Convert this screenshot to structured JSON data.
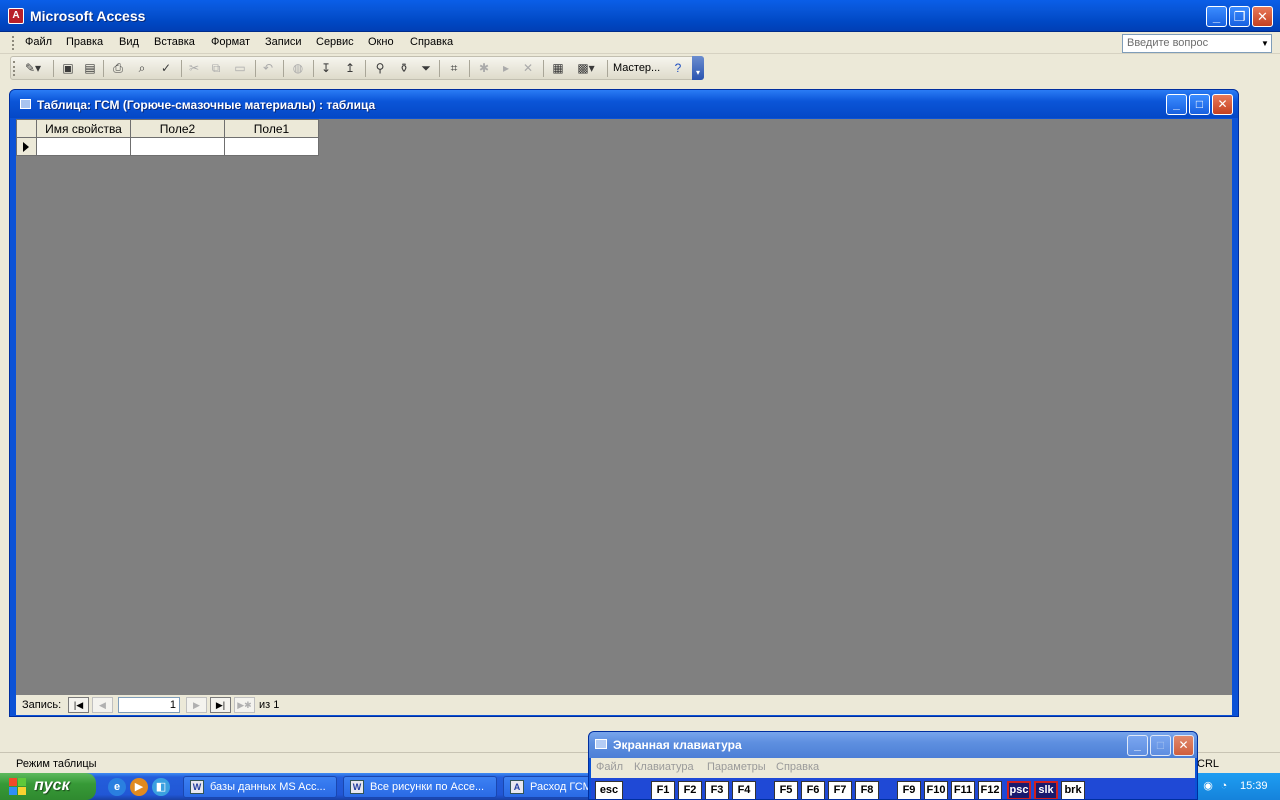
{
  "app": {
    "title": "Microsoft Access",
    "icon": "access-app-icon"
  },
  "menu": {
    "items": [
      "Файл",
      "Правка",
      "Вид",
      "Вставка",
      "Формат",
      "Записи",
      "Сервис",
      "Окно",
      "Справка"
    ],
    "ask_placeholder": "Введите вопрос"
  },
  "toolbar": {
    "wizard_label": "Мастер...",
    "buttons": [
      "view-design-icon",
      "save-icon",
      "properties-icon",
      "print-icon",
      "print-preview-icon",
      "spelling-icon",
      "cut-icon",
      "copy-icon",
      "paste-icon",
      "undo-icon",
      "hyperlink-icon",
      "sort-asc-icon",
      "sort-desc-icon",
      "filter-selection-icon",
      "filter-form-icon",
      "apply-filter-icon",
      "find-icon",
      "new-record-icon",
      "delete-record-icon",
      "database-window-icon",
      "new-object-icon",
      "help-icon"
    ]
  },
  "child_window": {
    "title": "Таблица: ГСМ (Горюче-смазочные материалы) : таблица",
    "columns": [
      "Имя свойства",
      "Поле2",
      "Поле1"
    ]
  },
  "navigator": {
    "label": "Запись:",
    "current": "1",
    "of_text": "из  1"
  },
  "status": {
    "mode": "Режим таблицы",
    "right": "CRL"
  },
  "osk": {
    "title": "Экранная клавиатура",
    "menu": [
      "Файл",
      "Клавиатура",
      "Параметры",
      "Справка"
    ],
    "keys": [
      "esc",
      "F1",
      "F2",
      "F3",
      "F4",
      "F5",
      "F6",
      "F7",
      "F8",
      "F9",
      "F10",
      "F11",
      "F12",
      "psc",
      "slk",
      "brk"
    ],
    "active_keys": [
      "psc",
      "slk"
    ]
  },
  "taskbar": {
    "start_label": "пуск",
    "tasks": [
      "базы данных MS Acc...",
      "Все рисунки по Acce...",
      "Расход ГСМ"
    ],
    "clock": "15:39"
  },
  "colors": {
    "xp_blue": "#0856d8",
    "mdi_gray": "#808080",
    "start_green": "#379a37"
  }
}
